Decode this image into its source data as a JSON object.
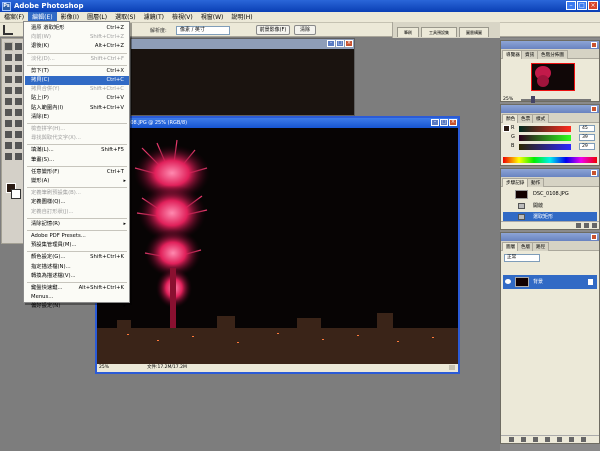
{
  "window": {
    "title": "Adobe Photoshop"
  },
  "menubar": [
    "檔案(F)",
    "編輯(E)",
    "影像(I)",
    "圖層(L)",
    "選取(S)",
    "濾鏡(T)",
    "檢視(V)",
    "視窗(W)",
    "說明(H)"
  ],
  "options": {
    "resolution_label": "解析度:",
    "units": "像素 / 英寸",
    "front_image_btn": "前景影像(F)",
    "clear_btn": "清除"
  },
  "palette_well": [
    "筆刷",
    "工具預設集",
    "圖層構圖"
  ],
  "doc": {
    "title": "DSC_0108.JPG @ 25% (RGB/8)",
    "zoom": "25%",
    "size": "文件:17.2M/17.2M"
  },
  "edit_menu": [
    {
      "label": "還原 選取矩形",
      "shortcut": "Ctrl+Z",
      "state": "normal"
    },
    {
      "label": "向前(W)",
      "shortcut": "Shift+Ctrl+Z",
      "state": "disabled"
    },
    {
      "label": "退後(K)",
      "shortcut": "Alt+Ctrl+Z",
      "state": "normal"
    },
    {
      "type": "sep"
    },
    {
      "label": "淡化(D)...",
      "shortcut": "Shift+Ctrl+F",
      "state": "disabled"
    },
    {
      "type": "sep"
    },
    {
      "label": "剪下(T)",
      "shortcut": "Ctrl+X",
      "state": "normal"
    },
    {
      "label": "拷貝(C)",
      "shortcut": "Ctrl+C",
      "state": "highlighted"
    },
    {
      "label": "拷貝合併(Y)",
      "shortcut": "Shift+Ctrl+C",
      "state": "disabled"
    },
    {
      "label": "貼上(P)",
      "shortcut": "Ctrl+V",
      "state": "normal"
    },
    {
      "label": "貼入範圍內(I)",
      "shortcut": "Shift+Ctrl+V",
      "state": "normal"
    },
    {
      "label": "清除(E)",
      "shortcut": "",
      "state": "normal"
    },
    {
      "type": "sep"
    },
    {
      "label": "檢查拼字(H)...",
      "shortcut": "",
      "state": "disabled"
    },
    {
      "label": "尋找與取代文字(X)...",
      "shortcut": "",
      "state": "disabled"
    },
    {
      "type": "sep"
    },
    {
      "label": "填滿(L)...",
      "shortcut": "Shift+F5",
      "state": "normal"
    },
    {
      "label": "筆畫(S)...",
      "shortcut": "",
      "state": "normal"
    },
    {
      "type": "sep"
    },
    {
      "label": "任意變形(F)",
      "shortcut": "Ctrl+T",
      "state": "normal"
    },
    {
      "label": "變形(A)",
      "shortcut": "",
      "state": "normal",
      "submenu": true
    },
    {
      "type": "sep"
    },
    {
      "label": "定義筆刷預設集(B)...",
      "shortcut": "",
      "state": "disabled"
    },
    {
      "label": "定義圖樣(Q)...",
      "shortcut": "",
      "state": "normal"
    },
    {
      "label": "定義自訂形狀(J)...",
      "shortcut": "",
      "state": "disabled"
    },
    {
      "type": "sep"
    },
    {
      "label": "清除記憶(R)",
      "shortcut": "",
      "state": "normal",
      "submenu": true
    },
    {
      "type": "sep"
    },
    {
      "label": "Adobe PDF Presets...",
      "shortcut": "",
      "state": "normal"
    },
    {
      "label": "預設集管理員(M)...",
      "shortcut": "",
      "state": "normal"
    },
    {
      "type": "sep"
    },
    {
      "label": "顏色設定(G)...",
      "shortcut": "Shift+Ctrl+K",
      "state": "normal"
    },
    {
      "label": "指定描述檔(N)...",
      "shortcut": "",
      "state": "normal"
    },
    {
      "label": "轉換為描述檔(V)...",
      "shortcut": "",
      "state": "normal"
    },
    {
      "type": "sep"
    },
    {
      "label": "鍵盤快速鍵...",
      "shortcut": "Alt+Shift+Ctrl+K",
      "state": "normal"
    },
    {
      "label": "Menus...",
      "shortcut": "",
      "state": "normal"
    },
    {
      "label": "偏好設定(N)",
      "shortcut": "",
      "state": "normal",
      "submenu": true
    }
  ],
  "navigator": {
    "tabs": [
      "導覽器",
      "資訊",
      "色階分佈圖"
    ],
    "zoom": "25%"
  },
  "color_panel": {
    "tabs": [
      "顏色",
      "色票",
      "樣式"
    ],
    "r": "45",
    "g": "39",
    "b": "29",
    "labels": [
      "R",
      "G",
      "B"
    ]
  },
  "history": {
    "tabs": [
      "步驟記錄",
      "動作"
    ],
    "items": [
      "DSC_0108.JPG",
      "開啟",
      "選取矩形"
    ]
  },
  "layers": {
    "tabs": [
      "圖層",
      "色版",
      "路徑"
    ],
    "mode": "正常",
    "layer_name": "背景"
  }
}
